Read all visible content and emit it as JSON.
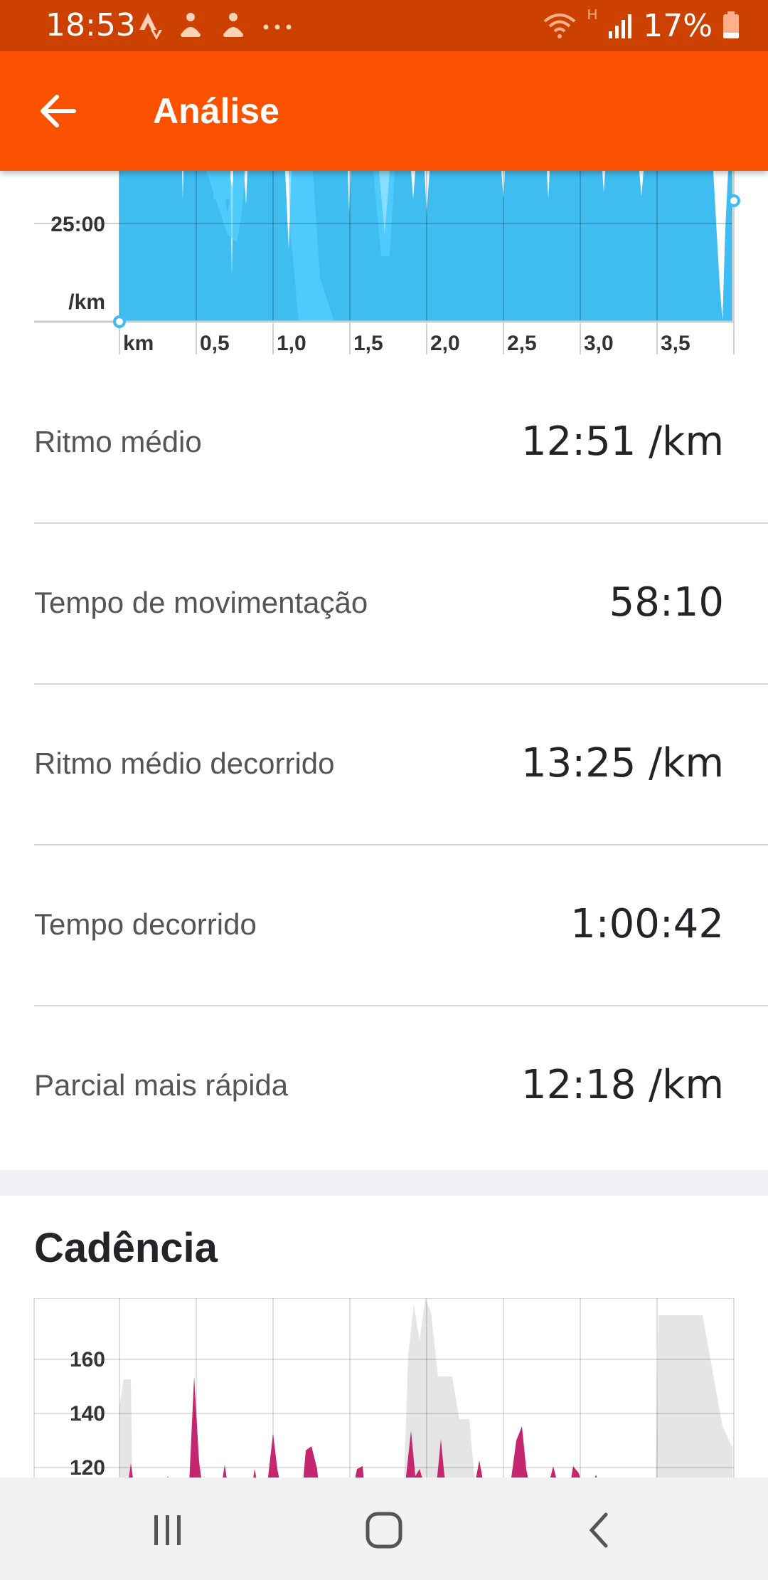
{
  "status_bar": {
    "time": "18:53",
    "network_label": "H",
    "battery": "17%"
  },
  "app_bar": {
    "title": "Análise"
  },
  "pace_chart": {
    "y_tick": "25:00",
    "y_unit": "/km",
    "x_unit": "km",
    "x_ticks": [
      "0,5",
      "1,0",
      "1,5",
      "2,0",
      "2,5",
      "3,0",
      "3,5"
    ]
  },
  "stats": [
    {
      "label": "Ritmo médio",
      "value": "12:51 /km"
    },
    {
      "label": "Tempo de movimentação",
      "value": "58:10"
    },
    {
      "label": "Ritmo médio decorrido",
      "value": "13:25 /km"
    },
    {
      "label": "Tempo decorrido",
      "value": "1:00:42"
    },
    {
      "label": "Parcial mais rápida",
      "value": "12:18 /km"
    }
  ],
  "cadence": {
    "title": "Cadência",
    "y_ticks": [
      "160",
      "140",
      "120"
    ]
  },
  "colors": {
    "accent": "#fc5200",
    "status": "#cc4100",
    "pace_fill": "#3fbdf0",
    "cadence_fill": "#c4276f"
  }
}
